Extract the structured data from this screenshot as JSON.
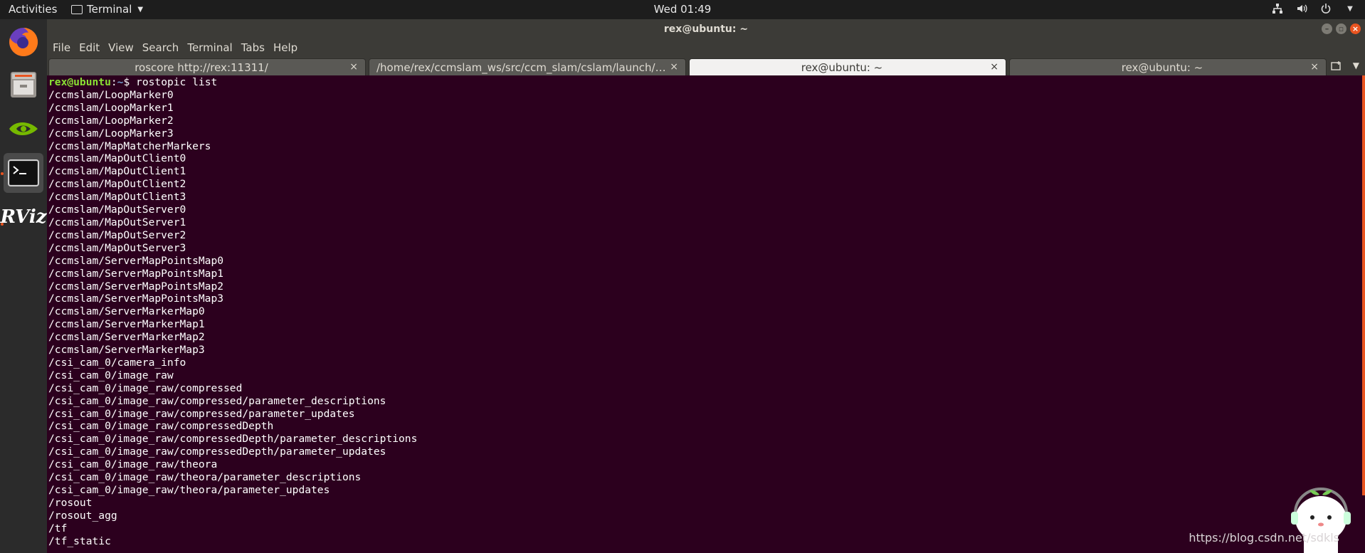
{
  "topbar": {
    "activities": "Activities",
    "app_name": "Terminal",
    "clock": "Wed 01:49"
  },
  "window": {
    "title": "rex@ubuntu: ~"
  },
  "menu": [
    "File",
    "Edit",
    "View",
    "Search",
    "Terminal",
    "Tabs",
    "Help"
  ],
  "tabs": [
    {
      "label": "roscore http://rex:11311/",
      "active": false
    },
    {
      "label": "/home/rex/ccmslam_ws/src/ccm_slam/cslam/launch/Serv…",
      "active": false
    },
    {
      "label": "rex@ubuntu: ~",
      "active": true
    },
    {
      "label": "rex@ubuntu: ~",
      "active": false
    }
  ],
  "terminal": {
    "prompt_user": "rex@ubuntu",
    "prompt_sep": ":",
    "prompt_path": "~",
    "prompt_symbol": "$ ",
    "command": "rostopic list",
    "lines": [
      "/ccmslam/LoopMarker0",
      "/ccmslam/LoopMarker1",
      "/ccmslam/LoopMarker2",
      "/ccmslam/LoopMarker3",
      "/ccmslam/MapMatcherMarkers",
      "/ccmslam/MapOutClient0",
      "/ccmslam/MapOutClient1",
      "/ccmslam/MapOutClient2",
      "/ccmslam/MapOutClient3",
      "/ccmslam/MapOutServer0",
      "/ccmslam/MapOutServer1",
      "/ccmslam/MapOutServer2",
      "/ccmslam/MapOutServer3",
      "/ccmslam/ServerMapPointsMap0",
      "/ccmslam/ServerMapPointsMap1",
      "/ccmslam/ServerMapPointsMap2",
      "/ccmslam/ServerMapPointsMap3",
      "/ccmslam/ServerMarkerMap0",
      "/ccmslam/ServerMarkerMap1",
      "/ccmslam/ServerMarkerMap2",
      "/ccmslam/ServerMarkerMap3",
      "/csi_cam_0/camera_info",
      "/csi_cam_0/image_raw",
      "/csi_cam_0/image_raw/compressed",
      "/csi_cam_0/image_raw/compressed/parameter_descriptions",
      "/csi_cam_0/image_raw/compressed/parameter_updates",
      "/csi_cam_0/image_raw/compressedDepth",
      "/csi_cam_0/image_raw/compressedDepth/parameter_descriptions",
      "/csi_cam_0/image_raw/compressedDepth/parameter_updates",
      "/csi_cam_0/image_raw/theora",
      "/csi_cam_0/image_raw/theora/parameter_descriptions",
      "/csi_cam_0/image_raw/theora/parameter_updates",
      "/rosout",
      "/rosout_agg",
      "/tf",
      "/tf_static"
    ]
  },
  "dock": [
    "firefox-icon",
    "files-icon",
    "nvidia-icon",
    "terminal-icon",
    "rviz-icon"
  ],
  "dock_labels": {
    "rviz": "RViz"
  },
  "watermark": "https://blog.csdn.net/sdkls",
  "colors": {
    "terminal_bg": "#2c001e",
    "prompt_user": "#8ae234",
    "prompt_path": "#729fcf",
    "accent": "#e95420"
  }
}
